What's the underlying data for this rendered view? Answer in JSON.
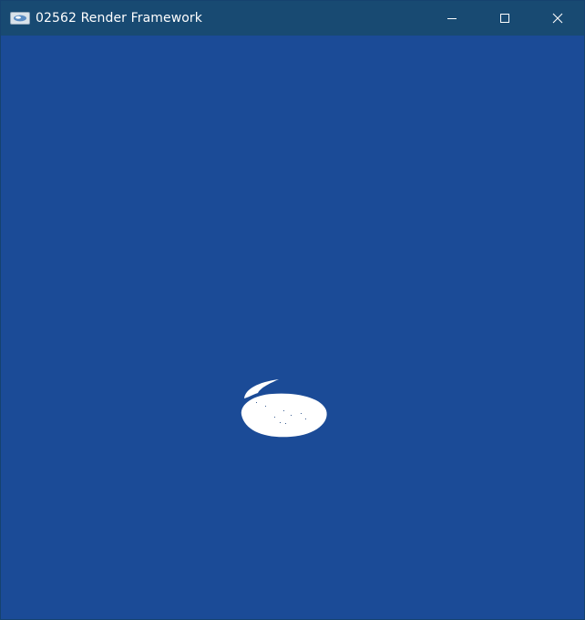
{
  "window": {
    "title": "02562 Render Framework",
    "icon": "render-app-icon",
    "background_color": "#1b4b97",
    "titlebar_color": "#184a72"
  },
  "controls": {
    "minimize_icon": "minimize-icon",
    "maximize_icon": "maximize-icon",
    "close_icon": "close-icon"
  },
  "scene": {
    "object_color": "#ffffff"
  }
}
